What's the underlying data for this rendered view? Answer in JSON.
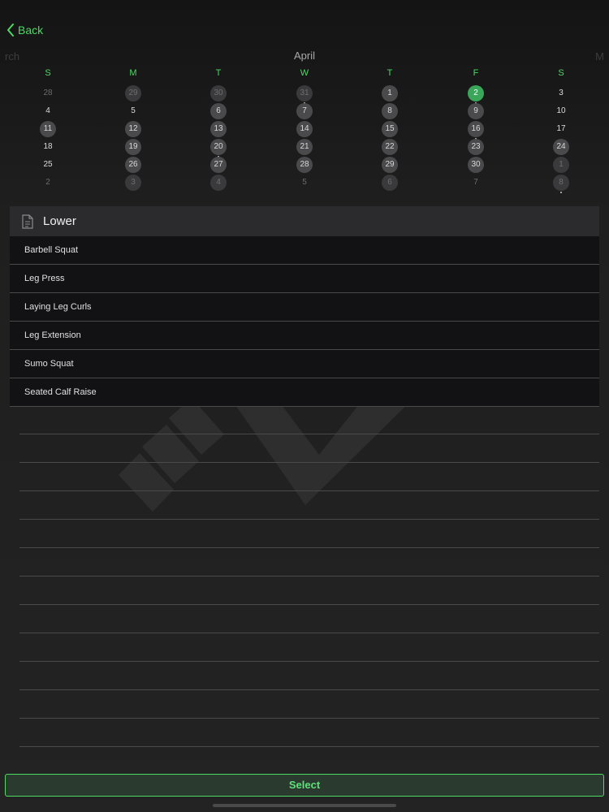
{
  "nav": {
    "back_label": "Back"
  },
  "calendar": {
    "month": "April",
    "prev_month_partial": "rch",
    "next_month_partial": "M",
    "weekdays": [
      "S",
      "M",
      "T",
      "W",
      "T",
      "F",
      "S"
    ],
    "weeks": [
      [
        {
          "d": "28",
          "outside": true,
          "marked": false
        },
        {
          "d": "29",
          "outside": true,
          "marked": true
        },
        {
          "d": "30",
          "outside": true,
          "marked": true
        },
        {
          "d": "31",
          "outside": true,
          "marked": true,
          "dot": true
        },
        {
          "d": "1",
          "marked": true
        },
        {
          "d": "2",
          "today": true,
          "dot": true
        },
        {
          "d": "3"
        }
      ],
      [
        {
          "d": "4"
        },
        {
          "d": "5"
        },
        {
          "d": "6",
          "marked": true
        },
        {
          "d": "7",
          "marked": true
        },
        {
          "d": "8",
          "marked": true
        },
        {
          "d": "9",
          "marked": true
        },
        {
          "d": "10"
        }
      ],
      [
        {
          "d": "11",
          "marked": true
        },
        {
          "d": "12",
          "marked": true
        },
        {
          "d": "13",
          "marked": true
        },
        {
          "d": "14",
          "marked": true
        },
        {
          "d": "15",
          "marked": true
        },
        {
          "d": "16",
          "marked": true,
          "dot": true
        },
        {
          "d": "17"
        }
      ],
      [
        {
          "d": "18"
        },
        {
          "d": "19",
          "marked": true
        },
        {
          "d": "20",
          "marked": true,
          "dot": true
        },
        {
          "d": "21",
          "marked": true
        },
        {
          "d": "22",
          "marked": true
        },
        {
          "d": "23",
          "marked": true
        },
        {
          "d": "24",
          "marked": true
        }
      ],
      [
        {
          "d": "25"
        },
        {
          "d": "26",
          "marked": true
        },
        {
          "d": "27",
          "marked": true
        },
        {
          "d": "28",
          "marked": true
        },
        {
          "d": "29",
          "marked": true
        },
        {
          "d": "30",
          "marked": true
        },
        {
          "d": "1",
          "outside": true,
          "marked": true
        }
      ],
      [
        {
          "d": "2",
          "outside": true
        },
        {
          "d": "3",
          "outside": true,
          "marked": true
        },
        {
          "d": "4",
          "outside": true,
          "marked": true
        },
        {
          "d": "5",
          "outside": true
        },
        {
          "d": "6",
          "outside": true,
          "marked": true
        },
        {
          "d": "7",
          "outside": true
        },
        {
          "d": "8",
          "outside": true,
          "marked": true,
          "dot": true
        }
      ]
    ]
  },
  "workout": {
    "title": "Lower",
    "icon": "document-icon",
    "exercises": [
      "Barbell Squat",
      "Leg Press",
      "Laying Leg Curls",
      "Leg Extension",
      "Sumo Squat",
      "Seated Calf Raise"
    ]
  },
  "footer": {
    "select_label": "Select"
  },
  "colors": {
    "accent": "#4cd964",
    "today": "#3aa65a",
    "marked_day": "#4a4a4c",
    "background": "#1c1c1e"
  }
}
